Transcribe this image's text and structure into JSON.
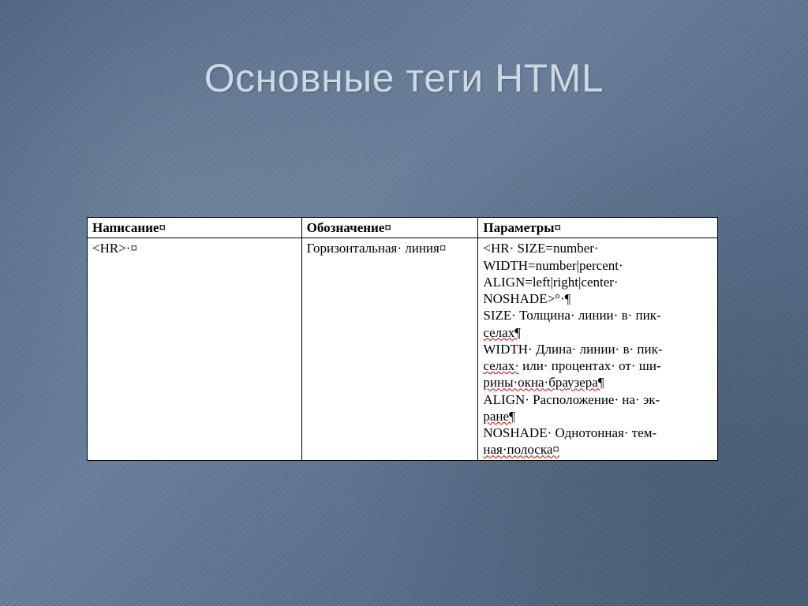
{
  "title": "Основные теги HTML",
  "headers": {
    "col1": "Написание¤",
    "col2": "Обозначение¤",
    "col3": "Параметры¤"
  },
  "row": {
    "col1": "<HR>·¤",
    "col2_l1": "Горизонтальная·",
    "col2_l2": "линия¤",
    "p_hr": "<HR·",
    "p_size": "SIZE=number·",
    "p_width": "WIDTH=number|percent·",
    "p_align": "ALIGN=left|right|center·",
    "p_noshade_close": "NOSHADE>°·¶",
    "p_size_desc_a": "SIZE·",
    "p_size_desc_b": "Толщина·",
    "p_size_desc_c": "линии·",
    "p_size_desc_d": "в·",
    "p_size_desc_e": "пик-",
    "p_size_desc2": "селах¶",
    "p_width_desc_a": "WIDTH·",
    "p_width_desc_b": "Длина·",
    "p_width_desc_c": "линии·",
    "p_width_desc_d": "в·",
    "p_width_desc_e": "пик-",
    "p_width_desc2_a": "селах·",
    "p_width_desc2_b": "или·",
    "p_width_desc2_c": "процентах·",
    "p_width_desc2_d": "от·",
    "p_width_desc2_e": "ши-",
    "p_width_desc3": "рины·окна·браузера¶",
    "p_align_desc_a": "ALIGN·",
    "p_align_desc_b": "Расположение·",
    "p_align_desc_c": "на·",
    "p_align_desc_d": "эк-",
    "p_align_desc2": "ране¶",
    "p_noshade_desc_a": "NOSHADE·",
    "p_noshade_desc_b": "Однотонная·",
    "p_noshade_desc_c": "тем-",
    "p_noshade_desc2": "ная·полоска¤"
  }
}
